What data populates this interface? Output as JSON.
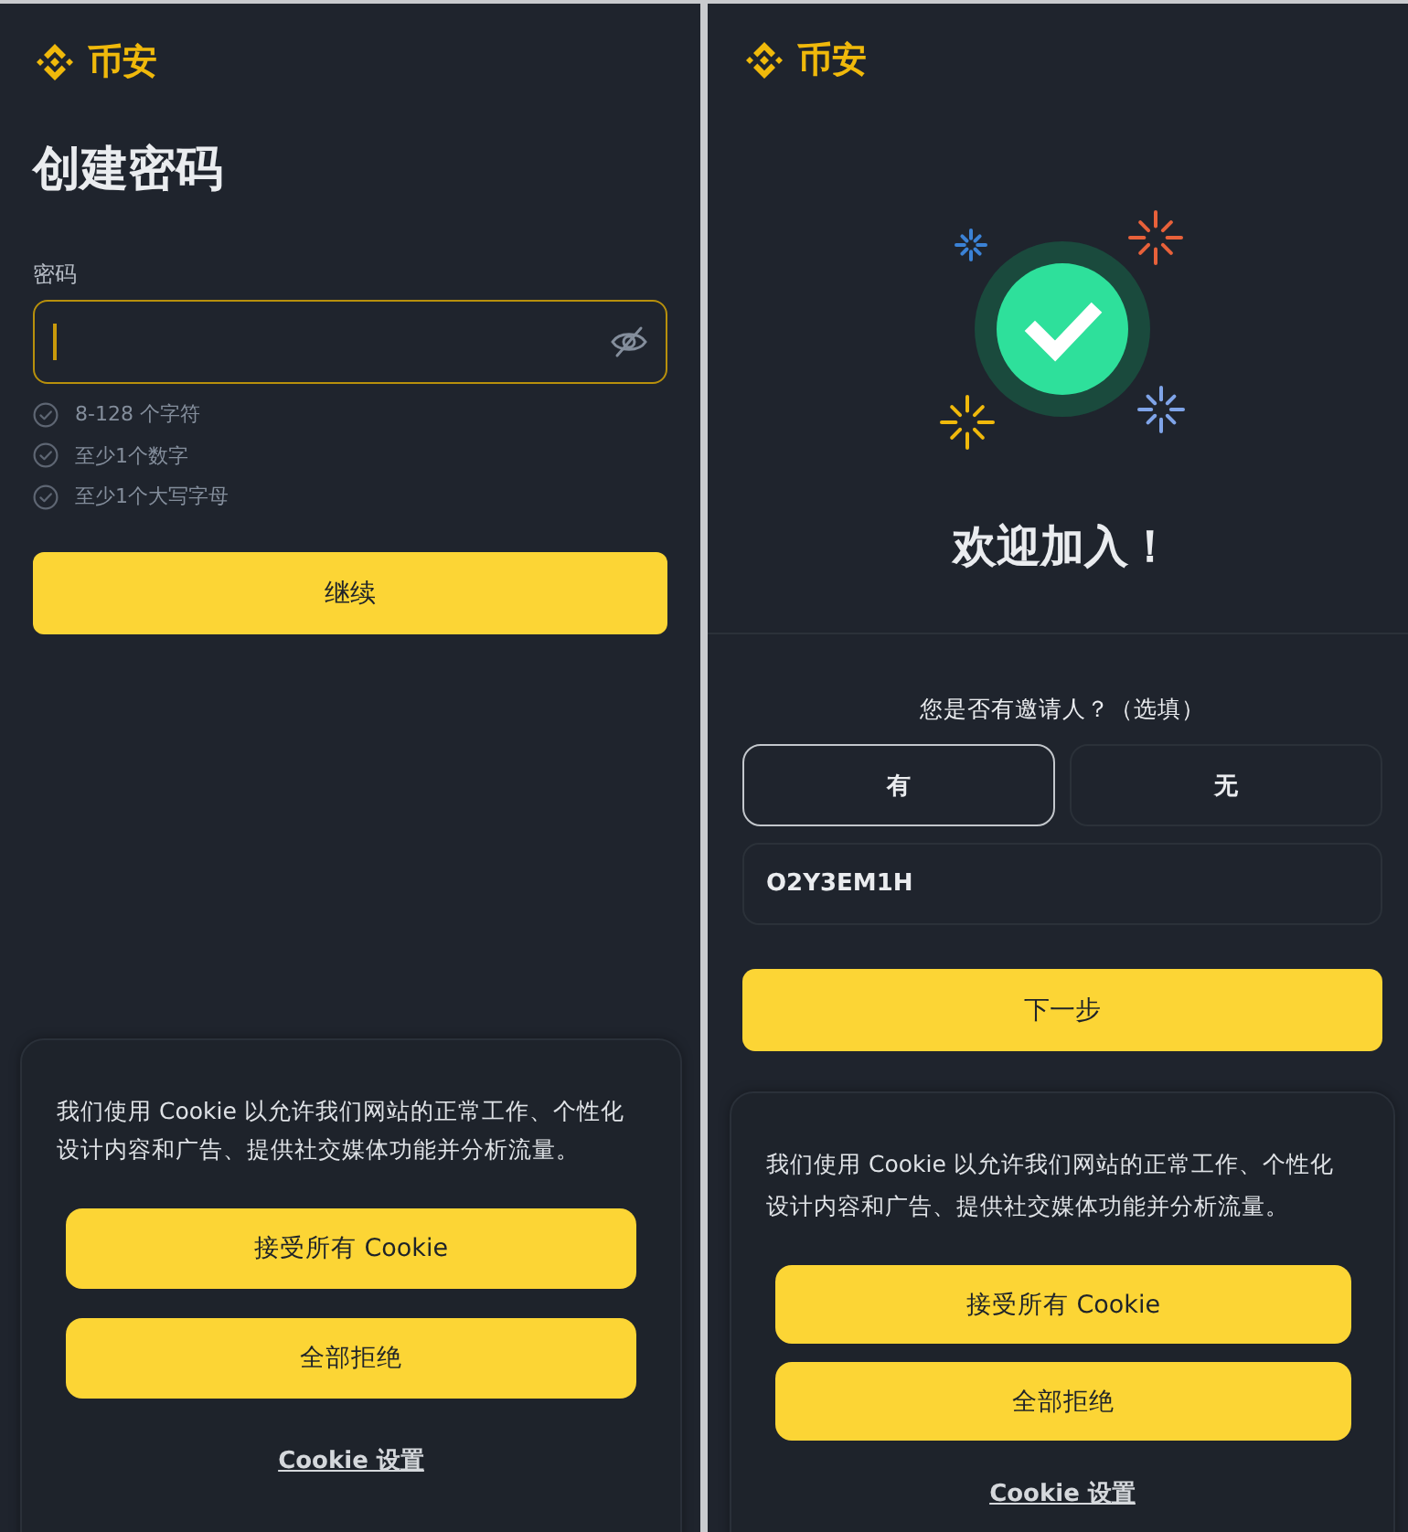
{
  "create_password_screen": {
    "logo": {
      "text": "币安"
    },
    "title": "创建密码",
    "password_field": {
      "label": "密码",
      "focused": true,
      "password_visible": false
    },
    "requirements": [
      {
        "text": "8-128 个字符",
        "met": false
      },
      {
        "text": "至少1个数字",
        "met": false
      },
      {
        "text": "至少1个大写字母",
        "met": false
      }
    ],
    "continue_button": "继续",
    "cookie_banner": {
      "text": "我们使用 Cookie 以允许我们网站的正常工作、个性化设计内容和广告、提供社交媒体功能并分析流量。",
      "buttons": [
        "接受所有 Cookie",
        "全部拒绝"
      ],
      "settings_link": "Cookie 设置"
    }
  },
  "welcome_screen": {
    "logo": {
      "text": "币安"
    },
    "title": "欢迎加入！",
    "referral_question": "您是否有邀请人？（选填）",
    "referral_options": [
      {
        "label": "有",
        "selected": true
      },
      {
        "label": "无",
        "selected": false
      }
    ],
    "referral_field": {
      "value": "O2Y3EM1H"
    },
    "next_button": "下一步",
    "cookie_banner": {
      "text": "我们使用 Cookie 以允许我们网站的正常工作、个性化设计内容和广告、提供社交媒体功能并分析流量。",
      "buttons": [
        "接受所有 Cookie",
        "全部拒绝"
      ],
      "settings_link": "Cookie 设置"
    }
  }
}
